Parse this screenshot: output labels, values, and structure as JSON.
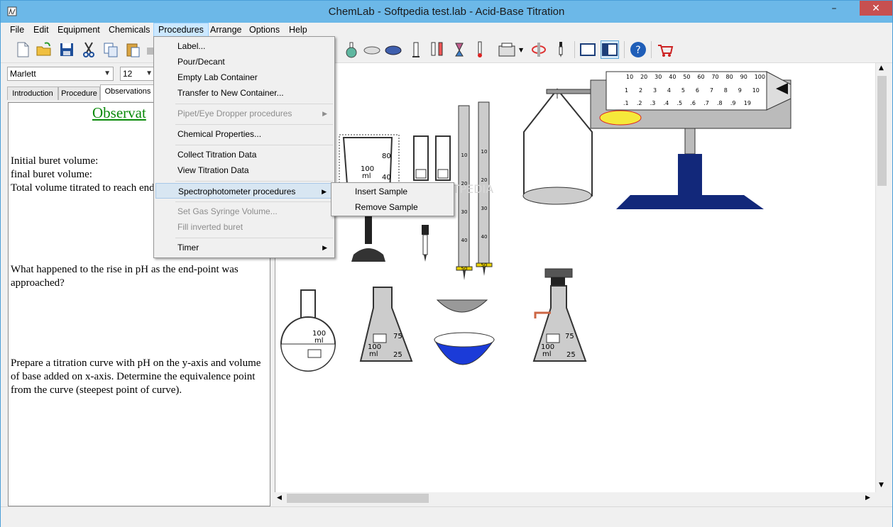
{
  "window": {
    "title": "ChemLab - Softpedia test.lab - Acid-Base Titration",
    "minimize": "–",
    "close": "✕"
  },
  "menubar": [
    "File",
    "Edit",
    "Equipment",
    "Chemicals",
    "Procedures",
    "Arrange",
    "Options",
    "Help"
  ],
  "font": {
    "name": "Marlett",
    "size": "12"
  },
  "tabs": [
    "Introduction",
    "Procedure",
    "Observations"
  ],
  "observations": {
    "heading": "Observat",
    "line1": "Initial buret volume:",
    "line2": "final buret volume:",
    "line3": "Total volume titrated to reach end",
    "q1a": "What happened to the rise in pH as the end-point was",
    "q1b": "approached?",
    "q2a": "Prepare a titration curve with pH on the y-axis and volume",
    "q2b": "of base added on x-axis. Determine the equivalence point",
    "q2c": "from the curve (steepest point of curve)."
  },
  "procedures_menu": {
    "label": "Label...",
    "pour": "Pour/Decant",
    "empty": "Empty Lab Container",
    "transfer": "Transfer to New Container...",
    "pipet": "Pipet/Eye Dropper procedures",
    "chemprops": "Chemical Properties...",
    "collect": "Collect Titration Data",
    "view": "View Titration Data",
    "spectro": "Spectrophotometer procedures",
    "gas": "Set Gas Syringe Volume...",
    "fill": "Fill inverted buret",
    "timer": "Timer"
  },
  "spectro_submenu": {
    "insert": "Insert Sample",
    "remove": "Remove Sample"
  },
  "canvas": {
    "watermark": "SOFTPEDIA",
    "beaker": {
      "v1": "80",
      "v2": "100",
      "v3": "ml",
      "v4": "40"
    },
    "flask": {
      "v1": "100",
      "v2": "ml"
    },
    "erlen1": {
      "v1": "75",
      "v2": "100",
      "v3": "ml",
      "v4": "25"
    },
    "erlen2": {
      "v1": "75",
      "v2": "100",
      "v3": "ml",
      "v4": "25"
    },
    "buret_ticks": [
      "10",
      "20",
      "30",
      "40",
      "50"
    ],
    "balance_top": [
      "10",
      "20",
      "30",
      "40",
      "50",
      "60",
      "70",
      "80",
      "90",
      "100"
    ],
    "balance_mid": [
      "1",
      "2",
      "3",
      "4",
      "5",
      "6",
      "7",
      "8",
      "9",
      "10"
    ],
    "balance_bot": [
      ".1",
      ".2",
      ".3",
      ".4",
      ".5",
      ".6",
      ".7",
      ".8",
      ".9",
      "19"
    ]
  }
}
